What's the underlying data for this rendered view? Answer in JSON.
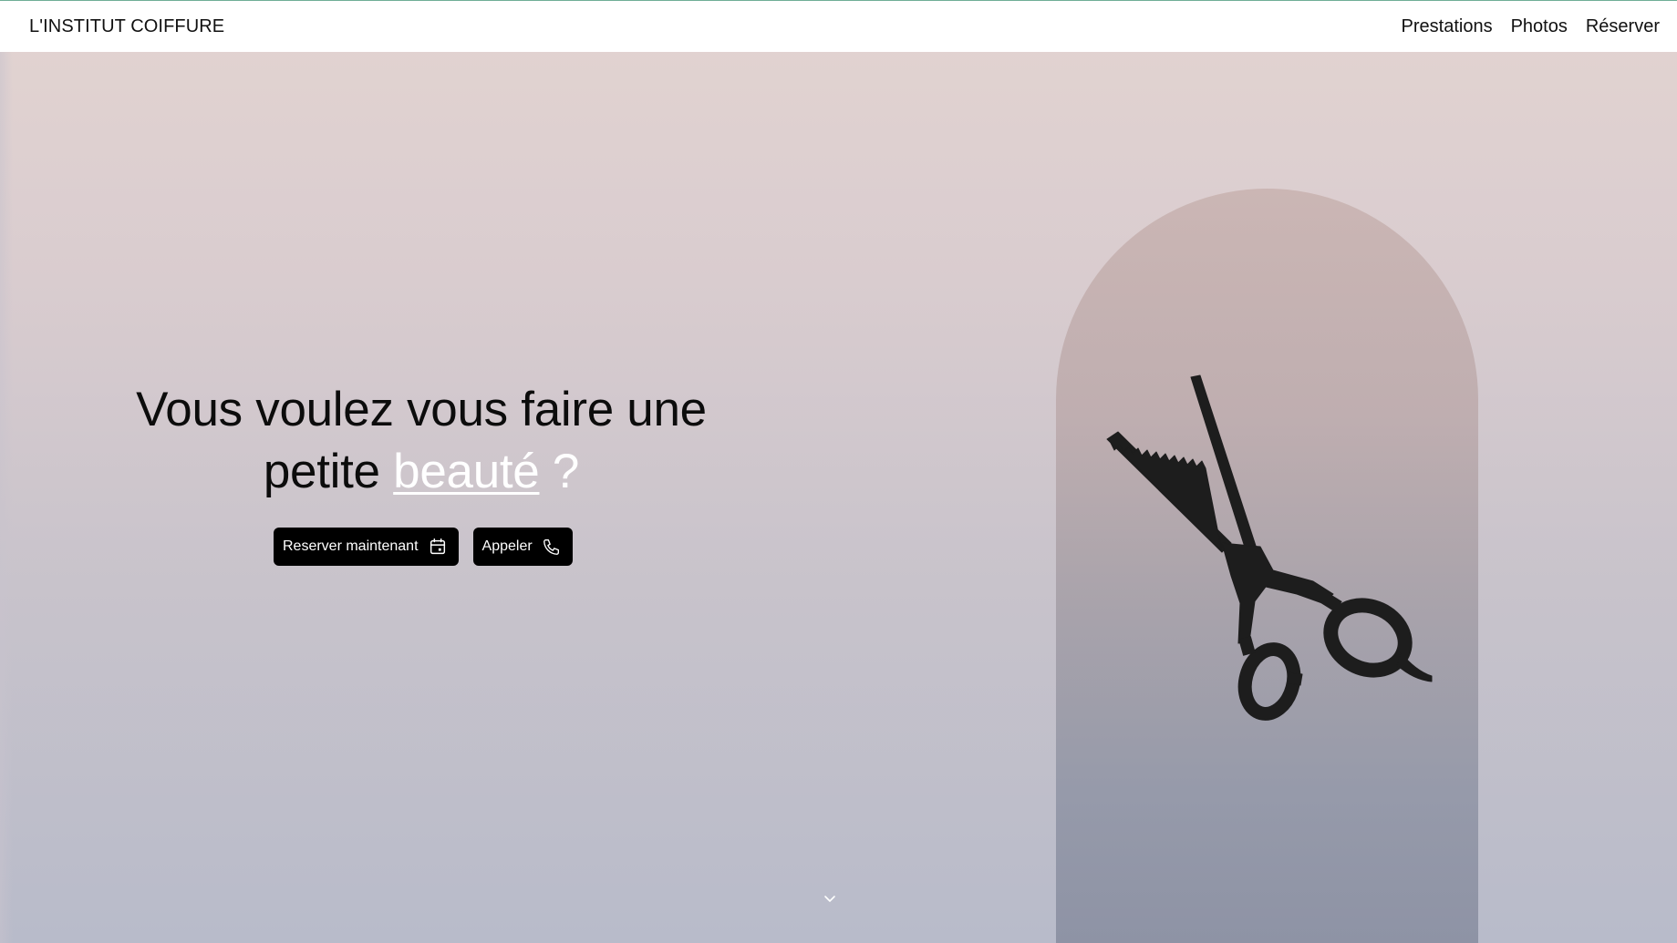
{
  "header": {
    "brand": "L'INSTITUT COIFFURE",
    "nav": [
      {
        "label": "Prestations"
      },
      {
        "label": "Photos"
      },
      {
        "label": "Réserver"
      }
    ]
  },
  "hero": {
    "title_line1": "Vous voulez vous faire une",
    "title_line2_prefix": "petite",
    "title_highlight": "beauté",
    "title_suffix": "?",
    "primary_button": {
      "label": "Reserver maintenant",
      "icon": "calendar-icon"
    },
    "secondary_button": {
      "label": "Appeler",
      "icon": "phone-icon"
    }
  },
  "decor": {
    "illustration": "thinning-scissors-icon",
    "scroll_indicator": "chevron-down-icon"
  },
  "colors": {
    "accent_text": "#ffffff",
    "button_bg": "#000000",
    "arch_top": "#cbb6b4",
    "arch_bottom": "#8e93a5"
  }
}
